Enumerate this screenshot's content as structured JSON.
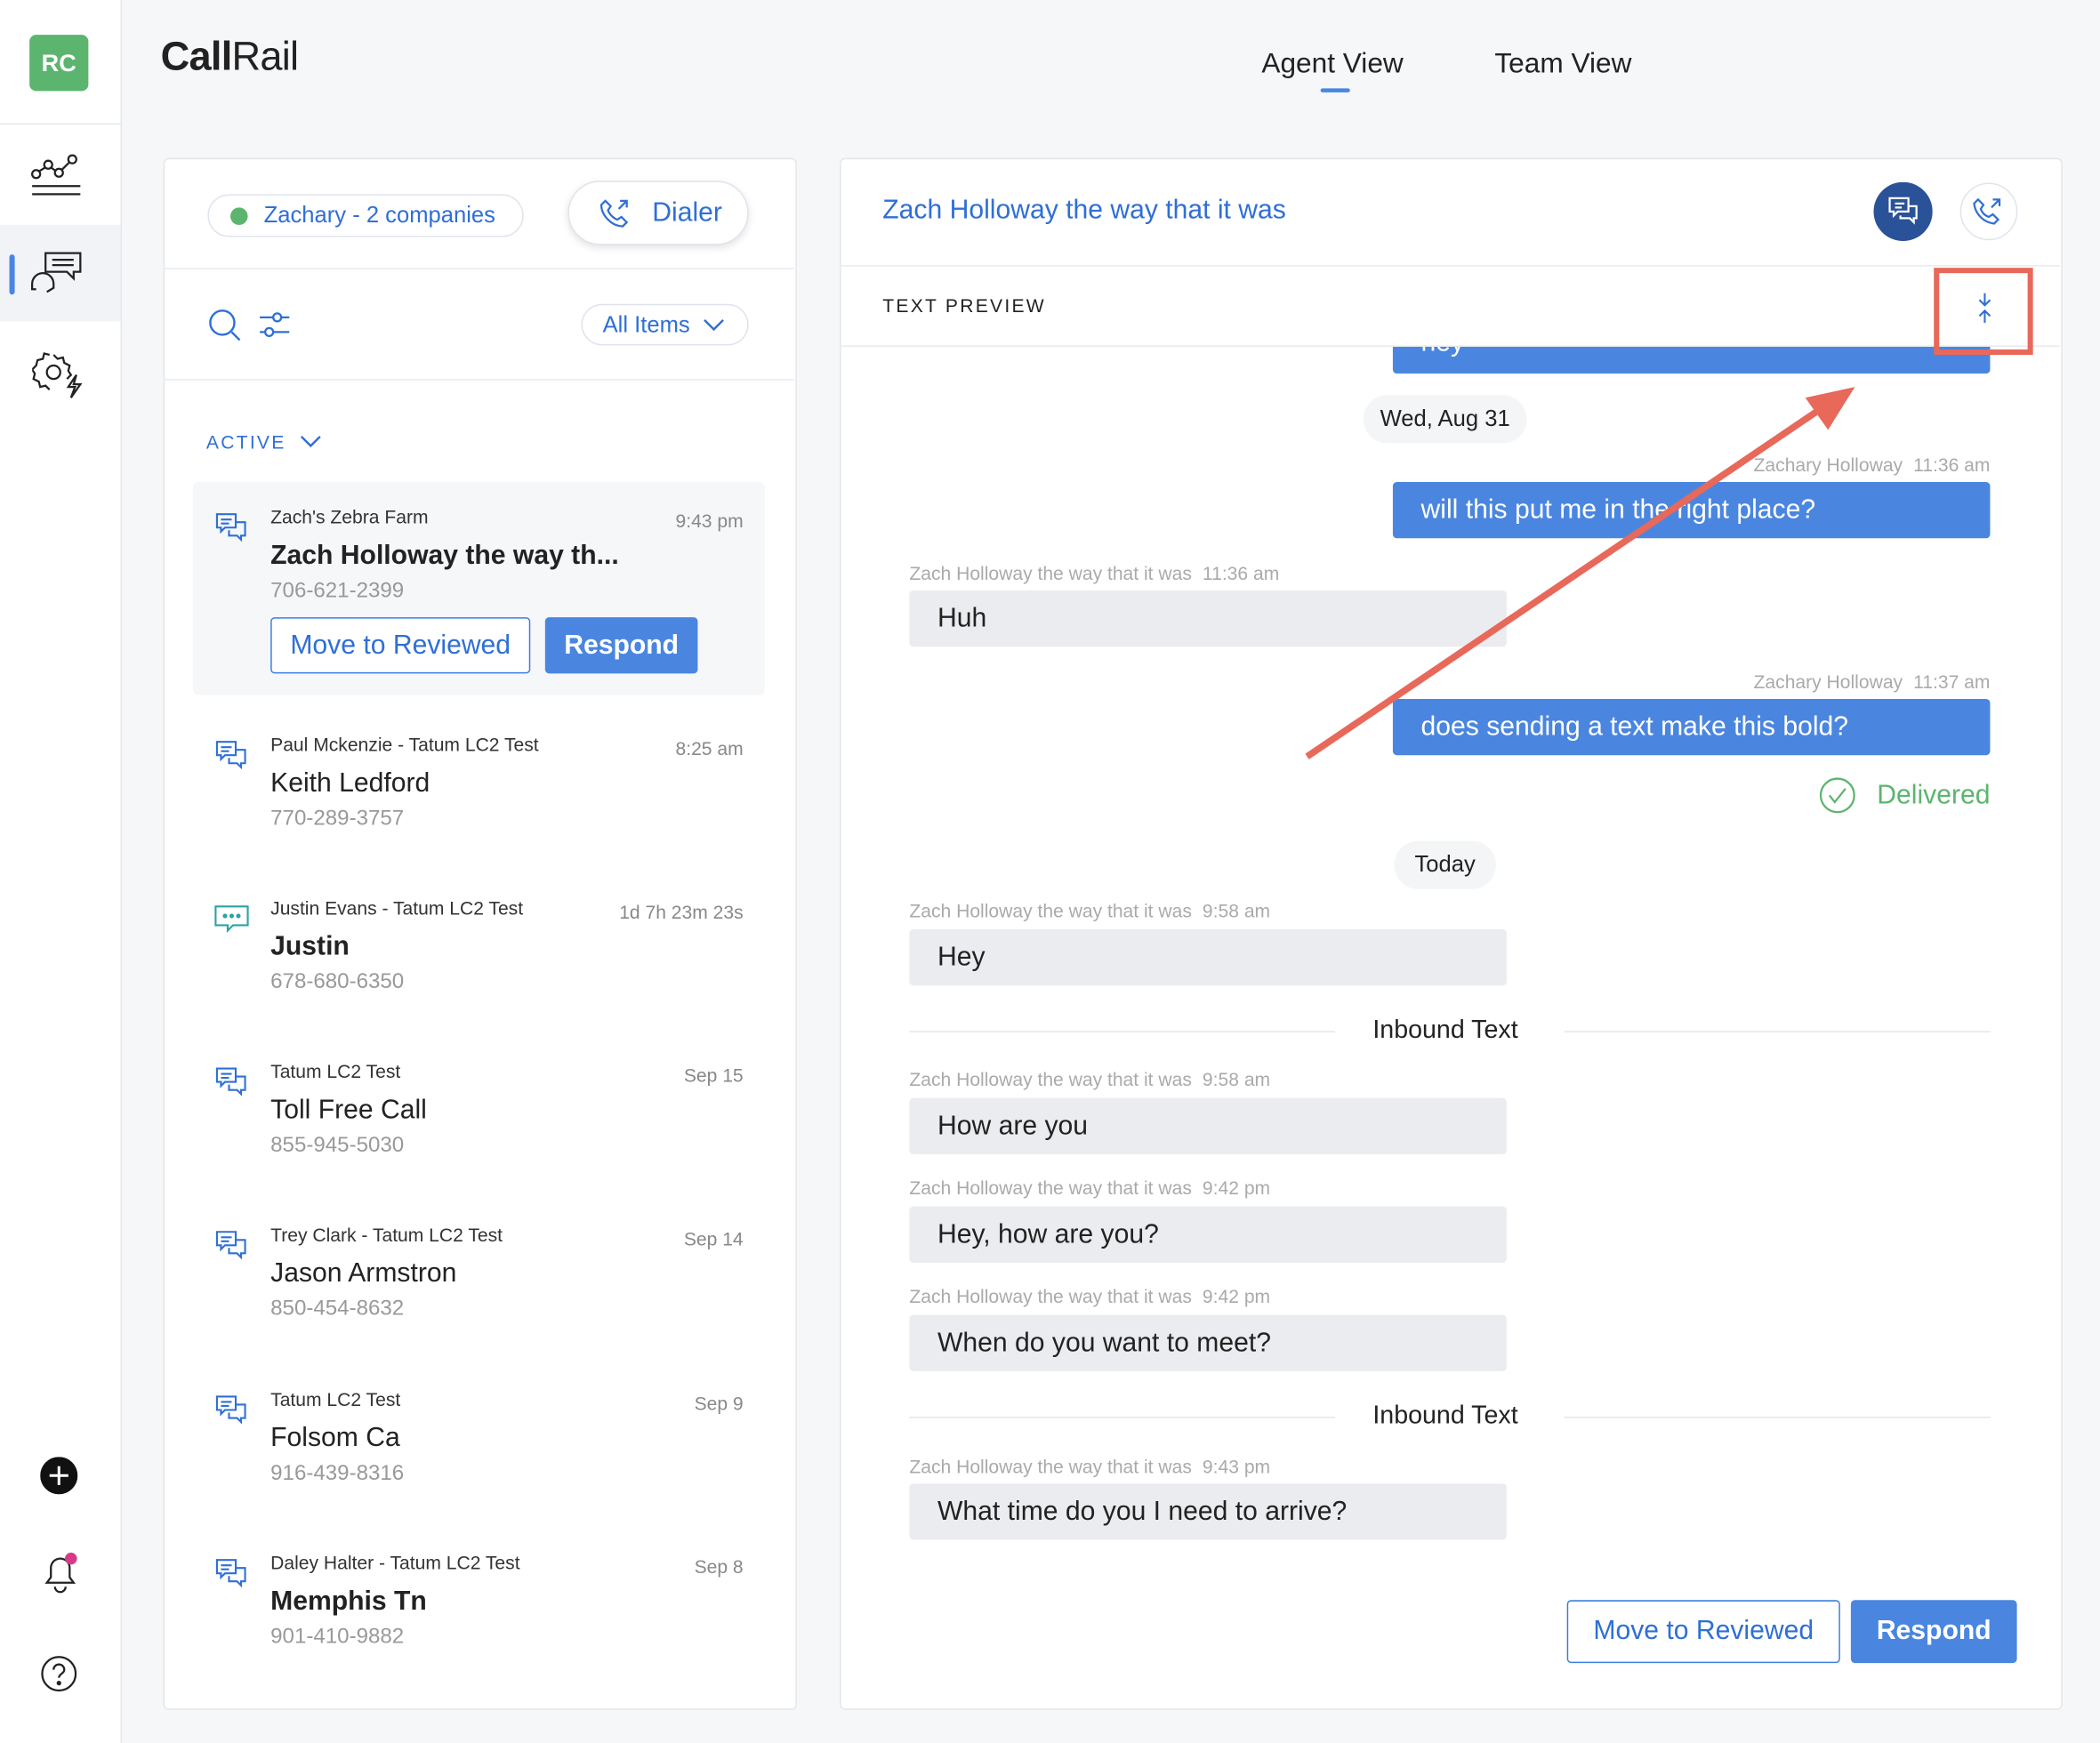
{
  "sidebar": {
    "logo": "RC",
    "items": [
      {
        "icon": "analytics-icon"
      },
      {
        "icon": "conversations-icon",
        "active": true
      },
      {
        "icon": "automation-settings-icon"
      }
    ],
    "bottom": [
      {
        "icon": "plus-icon"
      },
      {
        "icon": "bell-icon",
        "badge": true
      },
      {
        "icon": "help-icon"
      }
    ]
  },
  "header": {
    "brand_bold": "Call",
    "brand_light": "Rail",
    "tabs": [
      {
        "label": "Agent View",
        "active": true
      },
      {
        "label": "Team View"
      }
    ]
  },
  "left": {
    "agent": "Zachary - 2 companies",
    "status_color": "#5cb56e",
    "dialer": "Dialer",
    "filter": "All Items",
    "section": "ACTIVE",
    "items": [
      {
        "company": "Zach's Zebra Farm",
        "time": "9:43 pm",
        "name": "Zach Holloway the way th...",
        "phone": "706-621-2399",
        "bold": true,
        "selected": true,
        "move": "Move to Reviewed",
        "respond": "Respond"
      },
      {
        "company": "Paul Mckenzie - Tatum LC2 Test",
        "time": "8:25 am",
        "name": "Keith Ledford",
        "phone": "770-289-3757"
      },
      {
        "company": "Justin Evans - Tatum LC2 Test",
        "time": "1d 7h 23m 23s",
        "name": "Justin",
        "phone": "678-680-6350",
        "bold": true
      },
      {
        "company": "Tatum LC2 Test",
        "time": "Sep 15",
        "name": "Toll Free Call",
        "phone": "855-945-5030"
      },
      {
        "company": "Trey Clark - Tatum LC2 Test",
        "time": "Sep 14",
        "name": "Jason Armstron",
        "phone": "850-454-8632"
      },
      {
        "company": "Tatum LC2 Test",
        "time": "Sep 9",
        "name": "Folsom Ca",
        "phone": "916-439-8316"
      },
      {
        "company": "Daley Halter - Tatum LC2 Test",
        "time": "Sep 8",
        "name": "Memphis Tn",
        "phone": "901-410-9882",
        "bold": true
      }
    ]
  },
  "right": {
    "title": "Zach Holloway the way that it was",
    "section": "TEXT PREVIEW",
    "partial": "hey",
    "date1": "Wed, Aug 31",
    "m1": {
      "sender": "Zachary Holloway",
      "time": "11:36 am",
      "text": "will this put me in the right place?"
    },
    "m2": {
      "sender": "Zach Holloway the way that it was",
      "time": "11:36 am",
      "text": "Huh"
    },
    "m3": {
      "sender": "Zachary Holloway",
      "time": "11:37 am",
      "text": "does sending a text make this bold?"
    },
    "delivered": "Delivered",
    "date2": "Today",
    "m4": {
      "sender": "Zach Holloway the way that it was",
      "time": "9:58 am",
      "text": "Hey"
    },
    "div1": "Inbound Text",
    "m5": {
      "sender": "Zach Holloway the way that it was",
      "time": "9:58 am",
      "text": "How are you"
    },
    "m6": {
      "sender": "Zach Holloway the way that it was",
      "time": "9:42 pm",
      "text": "Hey, how are you?"
    },
    "m7": {
      "sender": "Zach Holloway the way that it was",
      "time": "9:42 pm",
      "text": "When do you want to meet?"
    },
    "div2": "Inbound Text",
    "m8": {
      "sender": "Zach Holloway the way that it was",
      "time": "9:43 pm",
      "text": "What time do you I need to arrive?"
    },
    "move": "Move to Reviewed",
    "respond": "Respond"
  },
  "colors": {
    "accent": "#4a86e0",
    "link": "#2f6fd6",
    "annotation": "#e8685a",
    "success": "#5cb56e"
  }
}
